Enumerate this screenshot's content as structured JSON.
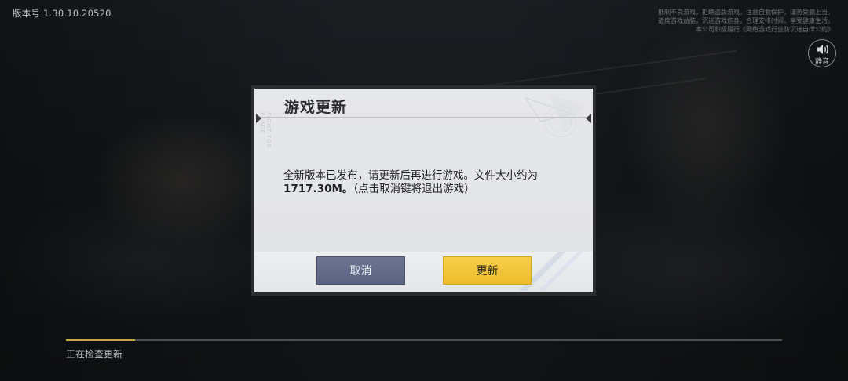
{
  "app": {
    "version_label": "版本号",
    "version_number": "1.30.10.20520"
  },
  "health_notice": {
    "lines": [
      "抵制不良游戏，拒绝盗版游戏。注意自我保护，谨防受骗上当。",
      "适度游戏益脑，沉迷游戏伤身。合理安排时间，享受健康生活。",
      "本公司积极履行《网络游戏行业防沉迷自律公约》"
    ]
  },
  "mute": {
    "label": "静音",
    "icon": "speaker-icon"
  },
  "dialog": {
    "title": "游戏更新",
    "side_text": "FIGHT FOR PEACE",
    "message_line1": "全新版本已发布，请更新后再进行游戏。文件大小约为",
    "message_line2_size": "1717.30M。",
    "message_line2_rest": "（点击取消键将退出游戏）",
    "cancel_label": "取消",
    "update_label": "更新"
  },
  "progress": {
    "status_text": "正在检查更新",
    "fraction": 0.097
  },
  "colors": {
    "cancel_button": "#5f6884",
    "update_button": "#f2c43a",
    "progress_fill": "#c8a545"
  }
}
